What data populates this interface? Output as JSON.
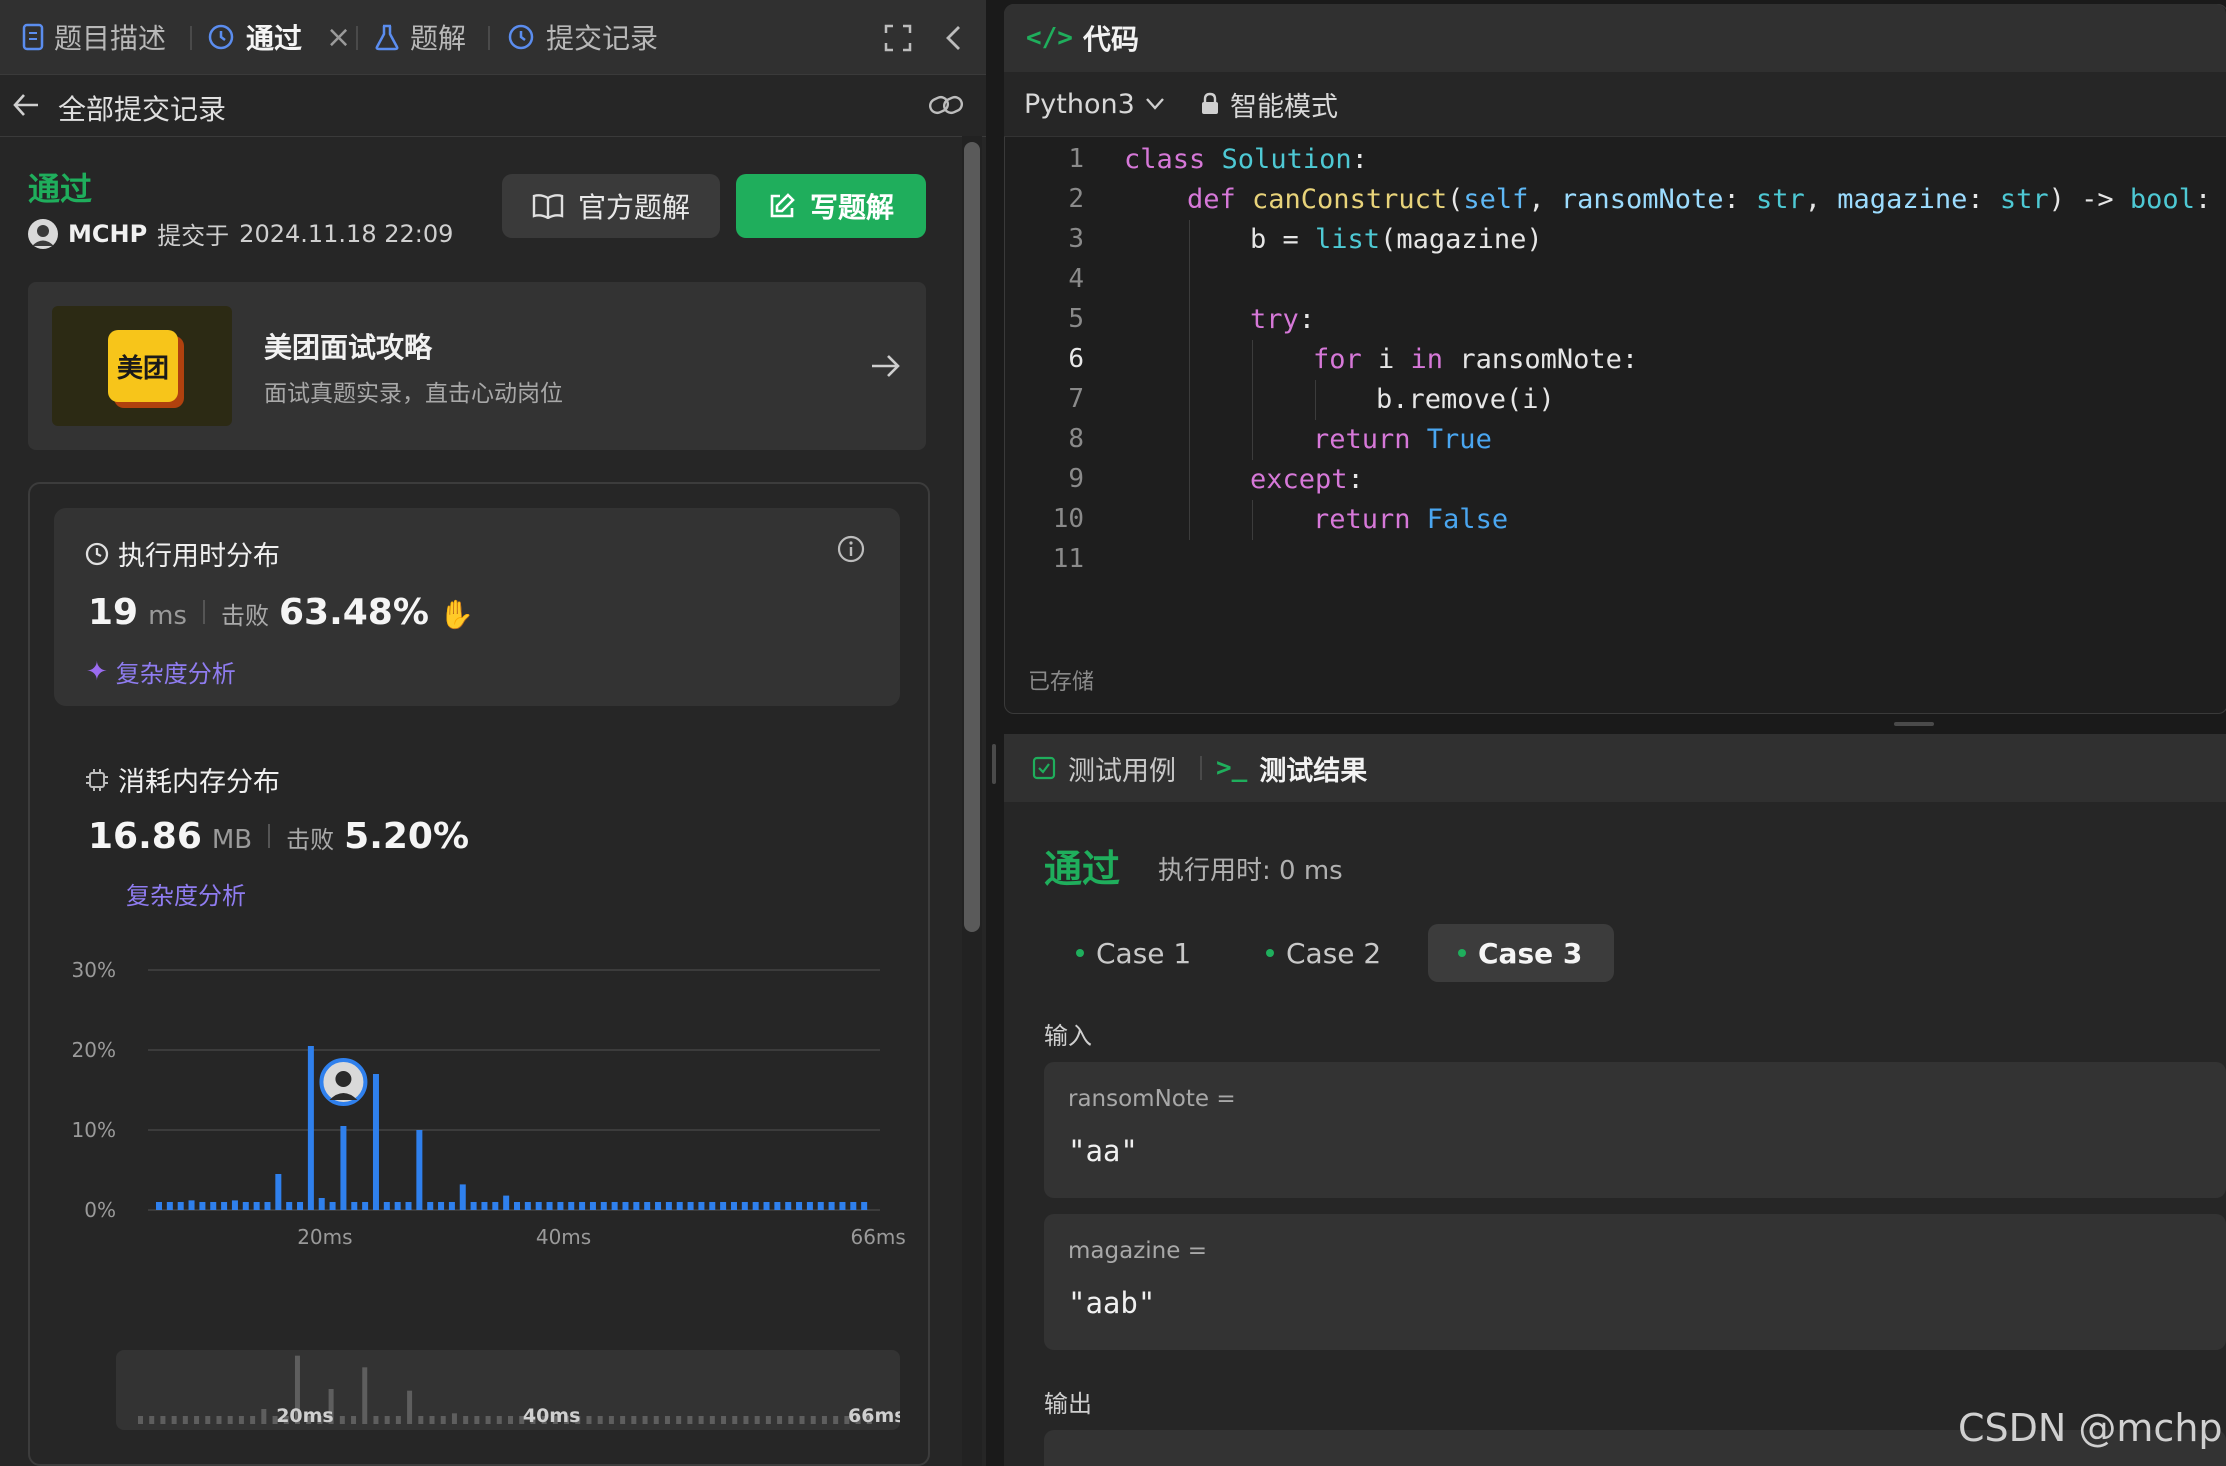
{
  "tabs": [
    {
      "label": "题目描述",
      "icon": "document-icon"
    },
    {
      "label": "通过",
      "icon": "history-icon"
    },
    {
      "label": "题解",
      "icon": "flask-icon"
    },
    {
      "label": "提交记录",
      "icon": "history-icon"
    }
  ],
  "subheader": {
    "back_label": "全部提交记录"
  },
  "submission": {
    "status": "通过",
    "user": "MCHP",
    "submitted_prefix": "提交于",
    "submitted_at": "2024.11.18 22:09",
    "official_btn": "官方题解",
    "write_btn": "写题解"
  },
  "banner": {
    "logo_text": "美团",
    "title": "美团面试攻略",
    "subtitle": "面试真题实录，直击心动岗位"
  },
  "runtime": {
    "title": "执行用时分布",
    "value": "19",
    "unit": "ms",
    "beat_label": "击败",
    "beat_value": "63.48%",
    "complexity": "复杂度分析"
  },
  "memory": {
    "title": "消耗内存分布",
    "value": "16.86",
    "unit": "MB",
    "beat_label": "击败",
    "beat_value": "5.20%",
    "complexity": "复杂度分析"
  },
  "chart_data": {
    "type": "bar",
    "y_ticks": [
      "30%",
      "20%",
      "10%",
      "0%"
    ],
    "ylim": [
      0,
      30
    ],
    "x_ticks": [
      "20ms",
      "40ms",
      "66ms"
    ],
    "values": [
      1,
      1,
      1,
      1.2,
      1,
      1,
      1,
      1.2,
      1,
      1,
      1,
      4.5,
      1,
      1,
      20.5,
      1.5,
      1,
      10.5,
      1,
      1,
      17,
      1,
      1,
      1,
      10,
      1,
      1,
      1,
      3.2,
      1,
      1,
      1,
      1.8,
      1,
      1,
      1,
      1,
      1,
      1,
      1,
      1,
      1,
      1,
      1,
      1,
      1,
      1,
      1,
      1,
      1,
      1,
      1,
      1,
      1,
      1,
      1,
      1,
      1,
      1,
      1,
      1,
      1,
      1,
      1,
      1,
      1
    ],
    "highlight_index": 17,
    "grid": true
  },
  "code": {
    "tab_label": "代码",
    "language": "Python3",
    "mode": "智能模式",
    "saved": "已存储",
    "line_numbers": [
      "1",
      "2",
      "3",
      "4",
      "5",
      "6",
      "7",
      "8",
      "9",
      "10",
      "11"
    ],
    "lines": [
      {
        "i": 0,
        "t": [
          [
            "kw",
            "class "
          ],
          [
            "cls",
            "Solution"
          ],
          [
            "",
            "："
          ]
        ]
      },
      {
        "i": 1,
        "t": [
          [
            "kw",
            "def "
          ],
          [
            "fn",
            "canConstruct"
          ],
          [
            "",
            "("
          ],
          [
            "sf",
            "self"
          ],
          [
            "",
            ", "
          ],
          [
            "param",
            "ransomNote"
          ],
          [
            "",
            ": "
          ],
          [
            "ty",
            "str"
          ],
          [
            "",
            ", "
          ],
          [
            "param",
            "magazine"
          ],
          [
            "",
            ": "
          ],
          [
            "ty",
            "str"
          ],
          [
            "",
            ") -> "
          ],
          [
            "ty",
            "bool"
          ],
          [
            "",
            ":"
          ]
        ]
      },
      {
        "i": 2,
        "t": [
          [
            "",
            "b = "
          ],
          [
            "ty",
            "list"
          ],
          [
            "",
            "(magazine)"
          ]
        ]
      },
      {
        "i": 2,
        "t": []
      },
      {
        "i": 2,
        "t": [
          [
            "kw",
            "try"
          ],
          [
            "",
            ":"
          ]
        ]
      },
      {
        "i": 3,
        "t": [
          [
            "kw",
            "for "
          ],
          [
            "",
            "i "
          ],
          [
            "kw",
            "in "
          ],
          [
            "",
            "ransomNote:"
          ]
        ]
      },
      {
        "i": 4,
        "t": [
          [
            "",
            "b.remove(i)"
          ]
        ]
      },
      {
        "i": 3,
        "t": [
          [
            "kw",
            "return "
          ],
          [
            "bool",
            "True"
          ]
        ]
      },
      {
        "i": 2,
        "t": [
          [
            "kw",
            "except"
          ],
          [
            "",
            ":"
          ]
        ]
      },
      {
        "i": 3,
        "t": [
          [
            "kw",
            "return "
          ],
          [
            "bool",
            "False"
          ]
        ]
      },
      {
        "i": 0,
        "t": []
      }
    ]
  },
  "result": {
    "tab_cases": "测试用例",
    "tab_result": "测试结果",
    "status": "通过",
    "runtime": "执行用时: 0 ms",
    "cases": [
      "Case 1",
      "Case 2",
      "Case 3"
    ],
    "input_label": "输入",
    "inputs": [
      {
        "name": "ransomNote =",
        "value": "\"aa\""
      },
      {
        "name": "magazine =",
        "value": "\"aab\""
      }
    ],
    "output_label": "输出"
  },
  "watermark": "CSDN @mchp"
}
